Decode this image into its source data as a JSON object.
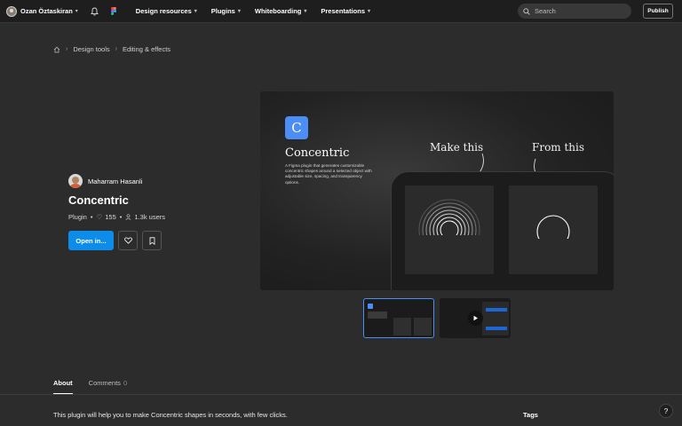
{
  "topbar": {
    "user_name": "Ozan Öztaskiran",
    "nav": [
      {
        "label": "Design resources"
      },
      {
        "label": "Plugins"
      },
      {
        "label": "Whiteboarding"
      },
      {
        "label": "Presentations"
      }
    ],
    "search_placeholder": "Search",
    "publish_label": "Publish",
    "icons": {
      "user_menu": "chevron-down-icon",
      "notifications": "bell-icon",
      "logo": "figma-logo-icon",
      "search": "search-icon"
    }
  },
  "breadcrumb": {
    "home_icon": "home-icon",
    "items": [
      "Design tools",
      "Editing & effects"
    ]
  },
  "plugin": {
    "author": "Maharram Hasanli",
    "title": "Concentric",
    "type": "Plugin",
    "likes": "155",
    "users": "1.3k users",
    "open_label": "Open in...",
    "like_icon": "heart-icon",
    "save_icon": "bookmark-icon"
  },
  "hero": {
    "badge_letter": "C",
    "title": "Concentric",
    "description": "A Figma plugin that generates customizable concentric shapes around a selected object with adjustable size, spacing, and transparency options.",
    "label_make": "Make this",
    "label_from": "From this",
    "accent": "#4c8df6"
  },
  "tabs": [
    {
      "label": "About",
      "count": ""
    },
    {
      "label": "Comments",
      "count": "0"
    }
  ],
  "about_text": "This plugin will help you to make Concentric shapes in seconds, with few clicks.",
  "tags_heading": "Tags",
  "help_label": "?",
  "colors": {
    "primary_button": "#0d8ce9",
    "background": "#2c2c2c",
    "topbar": "#1e1e1e"
  }
}
